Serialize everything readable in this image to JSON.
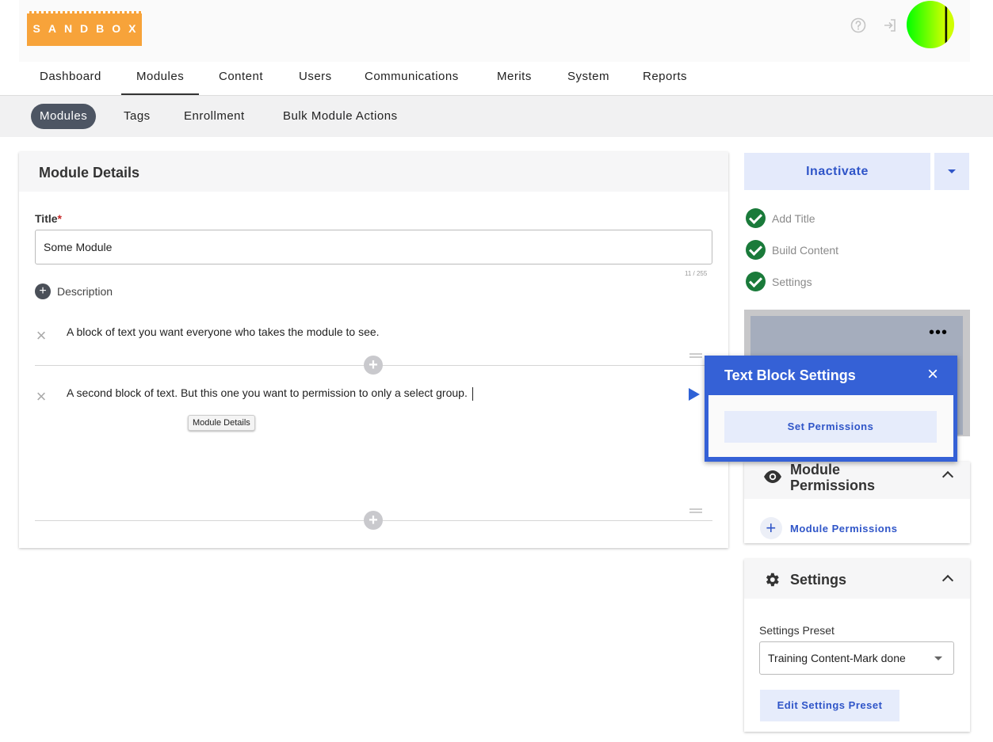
{
  "header": {
    "logo_text": "SANDBOX",
    "help_icon": "help-circle-icon",
    "logout_icon": "sign-out-icon",
    "avatar_icon": "user-avatar"
  },
  "main_nav": {
    "items": [
      "Dashboard",
      "Modules",
      "Content",
      "Users",
      "Communications",
      "Merits",
      "System",
      "Reports"
    ],
    "active": "Modules"
  },
  "sub_nav": {
    "items": [
      "Modules",
      "Tags",
      "Enrollment",
      "Bulk Module Actions"
    ],
    "active": "Modules"
  },
  "module_details": {
    "heading": "Module Details",
    "title_label": "Title",
    "required_mark": "*",
    "title_value": "Some Module",
    "char_counter": "11 / 255",
    "description_label": "Description",
    "blocks": [
      "A block of text you want everyone who takes the module to see.",
      "A second block of text. But this one you want to permission to only a select group."
    ],
    "tooltip": "Module Details"
  },
  "sidebar": {
    "inactivate_label": "Inactivate",
    "steps": [
      "Add Title",
      "Build Content",
      "Settings"
    ],
    "preview_menu": "•••",
    "text_block_settings": {
      "title": "Text Block Settings",
      "close": "×",
      "set_permissions_label": "Set Permissions"
    },
    "module_permissions": {
      "heading_line1": "Module",
      "heading_line2": "Permissions",
      "link_label": "Module Permissions"
    },
    "settings": {
      "heading": "Settings",
      "preset_label": "Settings Preset",
      "preset_value": "Training Content-Mark done",
      "edit_label": "Edit Settings Preset"
    }
  },
  "colors": {
    "accent": "#2f55c8",
    "logo": "#f7a33a",
    "popup": "#3561d6",
    "success": "#1a7a3a"
  }
}
